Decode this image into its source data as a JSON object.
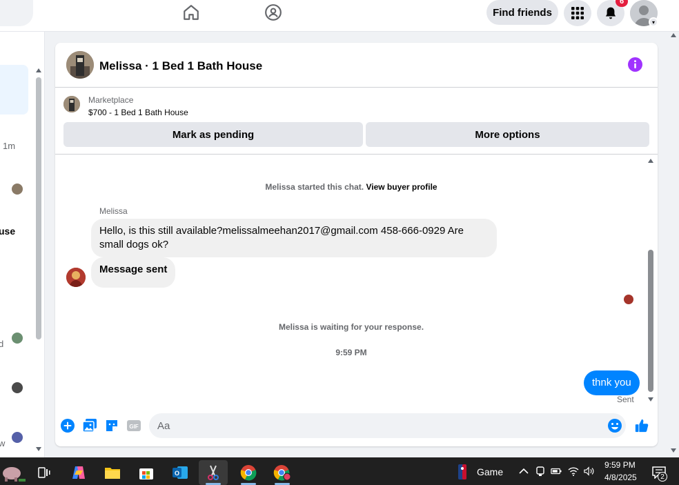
{
  "topbar": {
    "find_friends_label": "Find friends",
    "notification_count": "6"
  },
  "sidebar": {
    "time_label": "1m",
    "fragment_use": "use",
    "fragment_d": "d",
    "fragment_w": "w"
  },
  "chat": {
    "header_title": "Melissa · 1 Bed 1 Bath House",
    "marketplace": {
      "label": "Marketplace",
      "listing": "$700 - 1 Bed 1 Bath House",
      "mark_pending_label": "Mark as pending",
      "more_options_label": "More options"
    },
    "started_text": "Melissa started this chat.",
    "view_profile_link": "View buyer profile",
    "sender_name": "Melissa",
    "message_1": "Hello, is this still available?melissalmeehan2017@gmail.com 458-666-0929 Are small dogs ok?",
    "message_2": "Message sent",
    "waiting_text": "Melissa is waiting for your response.",
    "timestamp": "9:59 PM",
    "my_message": "thnk you",
    "sent_status": "Sent",
    "composer_placeholder": "Aa"
  },
  "taskbar": {
    "game_label": "Game",
    "time": "9:59 PM",
    "date": "4/8/2025",
    "notif_count": "2"
  },
  "colors": {
    "brand_blue": "#0084ff",
    "info_purple": "#a033ff",
    "badge_red": "#e41e3f"
  }
}
